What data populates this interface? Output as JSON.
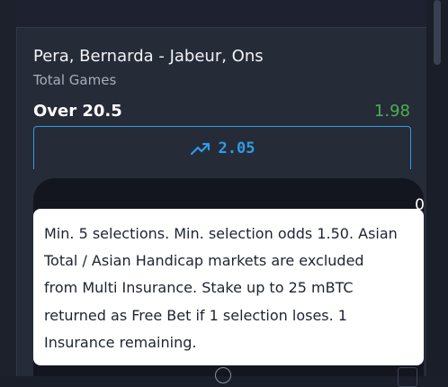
{
  "bet": {
    "match_title": "Pera, Bernarda - Jabeur, Ons",
    "market": "Total Games",
    "selection": "Over 20.5",
    "previous_odds": "1.98",
    "new_odds": "2.05",
    "odds_change_icon": "trending-up-icon"
  },
  "insurance": {
    "count": "0"
  },
  "tooltip": {
    "lines": [
      "Min. 5 selections. Min. selection odds 1.50. Asian",
      "Total / Asian Handicap markets are excluded",
      "from Multi Insurance. Stake up to 25 mBTC",
      "returned as Free Bet if 1 selection loses. 1",
      "Insurance remaining."
    ]
  },
  "colors": {
    "accent_blue": "#2d9ce6",
    "odds_green": "#4caf50",
    "panel_bg": "#262b38",
    "tooltip_bg": "#ffffff"
  }
}
